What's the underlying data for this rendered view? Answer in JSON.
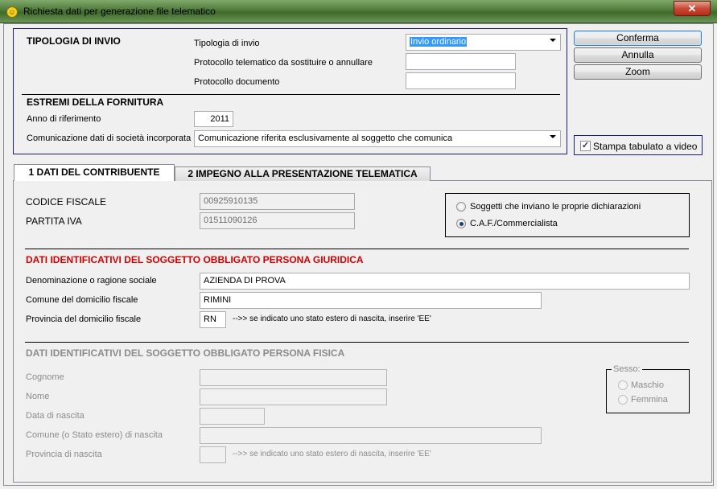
{
  "window": {
    "title": "Richiesta dati per generazione file telematico",
    "close_label": "✕"
  },
  "tipologia": {
    "heading": "TIPOLOGIA DI INVIO",
    "tipologia_label": "Tipologia di invio",
    "tipologia_value": "Invio ordinario",
    "protocollo_sost_label": "Protocollo telematico da sostituire o annullare",
    "protocollo_sost_value": "",
    "protocollo_doc_label": "Protocollo documento",
    "protocollo_doc_value": ""
  },
  "estremi": {
    "heading": "ESTREMI DELLA FORNITURA",
    "anno_label": "Anno di riferimento",
    "anno_value": "2011",
    "comunicazione_label": "Comunicazione dati di società incorporata",
    "comunicazione_value": "Comunicazione riferita esclusivamente al soggetto che comunica"
  },
  "buttons": {
    "conferma": "Conferma",
    "annulla": "Annulla",
    "zoom": "Zoom"
  },
  "stampa": {
    "label": "Stampa tabulato a video",
    "checked": true
  },
  "tabs": [
    {
      "label": "1 DATI DEL CONTRIBUENTE",
      "active": true
    },
    {
      "label": "2 IMPEGNO ALLA PRESENTAZIONE TELEMATICA",
      "active": false
    }
  ],
  "contribuente": {
    "cf_label": "CODICE FISCALE",
    "cf_value": "00925910135",
    "piva_label": "PARTITA IVA",
    "piva_value": "01511090126",
    "radio_soggetti": "Soggetti che inviano le proprie dichiarazioni",
    "radio_caf": "C.A.F./Commercialista",
    "selected": "caf"
  },
  "giuridica": {
    "heading": "DATI IDENTIFICATIVI DEL SOGGETTO OBBLIGATO PERSONA GIURIDICA",
    "denominazione_label": "Denominazione o ragione sociale",
    "denominazione_value": "AZIENDA DI PROVA",
    "comune_label": "Comune del domicilio fiscale",
    "comune_value": "RIMINI",
    "provincia_label": "Provincia del domicilio fiscale",
    "provincia_value": "RN",
    "provincia_note": "-->> se indicato uno stato estero di nascita, inserire 'EE'"
  },
  "fisica": {
    "heading": "DATI IDENTIFICATIVI DEL SOGGETTO OBBLIGATO PERSONA FISICA",
    "cognome_label": "Cognome",
    "nome_label": "Nome",
    "data_label": "Data di nascita",
    "comune_label": "Comune (o Stato estero) di nascita",
    "provincia_label": "Provincia di nascita",
    "provincia_note": "-->> se indicato uno stato estero di nascita, inserire 'EE'",
    "sesso_legend": "Sesso:",
    "maschio": "Maschio",
    "femmina": "Femmina"
  }
}
